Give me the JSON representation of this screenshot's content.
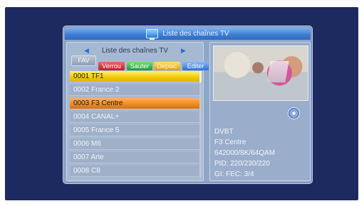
{
  "window": {
    "title": "Liste des chaînes TV"
  },
  "channel_panel": {
    "title": "Liste des chaînes TV",
    "tabs": {
      "fav": "FAV",
      "lock": "Verrou",
      "skip": "Sauter",
      "move": "Deplac",
      "edit": "Editer"
    },
    "channels": [
      "0001 TF1",
      "0002 France 2",
      "0003 F3 Centre",
      "0004 CANAL+",
      "0005 France 5",
      "0006 M6",
      "0007 Arte",
      "0008 C8"
    ]
  },
  "details": {
    "type": "DVBT",
    "name": "F3 Centre",
    "frequency": "642000/8K/64QAM",
    "pid": "PID: 220/230/220",
    "gi": "GI:   FEC: 3/4"
  },
  "colors": {
    "current_row": "#f0c900",
    "selected_row": "#f08a1e",
    "background": "#1c2a60"
  }
}
